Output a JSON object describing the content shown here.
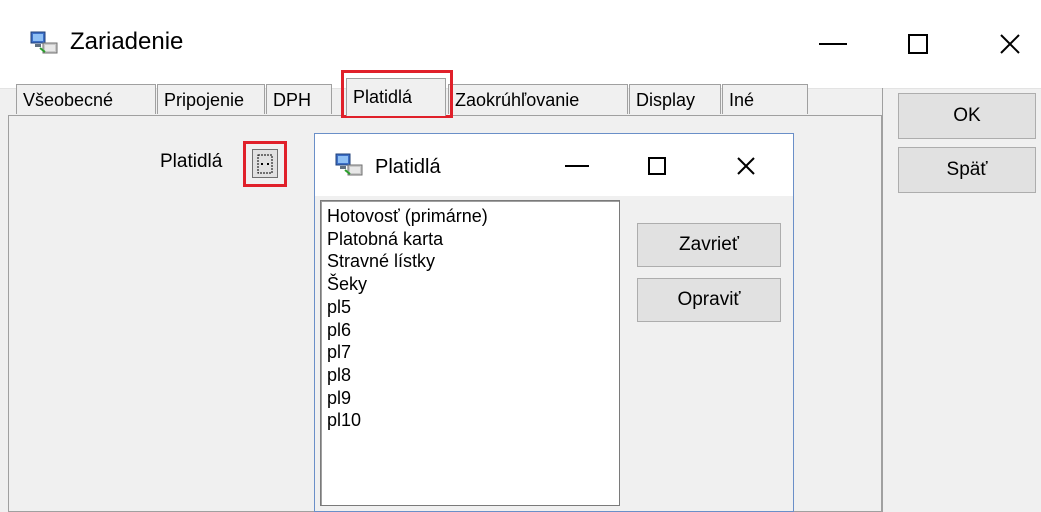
{
  "main_window": {
    "title": "Zariadenie",
    "icon": "computer-network-icon",
    "tabs": [
      {
        "label": "Všeobecné",
        "active": false
      },
      {
        "label": "Pripojenie",
        "active": false
      },
      {
        "label": "DPH",
        "active": false
      },
      {
        "label": "Platidlá",
        "active": true
      },
      {
        "label": "Zaokrúhľovanie",
        "active": false
      },
      {
        "label": "Display",
        "active": false
      },
      {
        "label": "Iné",
        "active": false
      }
    ],
    "ok_label": "OK",
    "back_label": "Späť",
    "field_label": "Platidlá",
    "field_button_icon": "ellipsis-icon"
  },
  "dialog": {
    "title": "Platidlá",
    "icon": "computer-network-icon",
    "items": [
      "Hotovosť (primárne)",
      "Platobná karta",
      "Stravné lístky",
      "Šeky",
      "pl5",
      "pl6",
      "pl7",
      "pl8",
      "pl9",
      "pl10"
    ],
    "close_label": "Zavrieť",
    "edit_label": "Opraviť"
  },
  "colors": {
    "highlight": "#e0202a",
    "window_bg": "#f0f0f0",
    "titlebar_bg": "#ffffff",
    "dialog_border": "#6a8fc8"
  }
}
